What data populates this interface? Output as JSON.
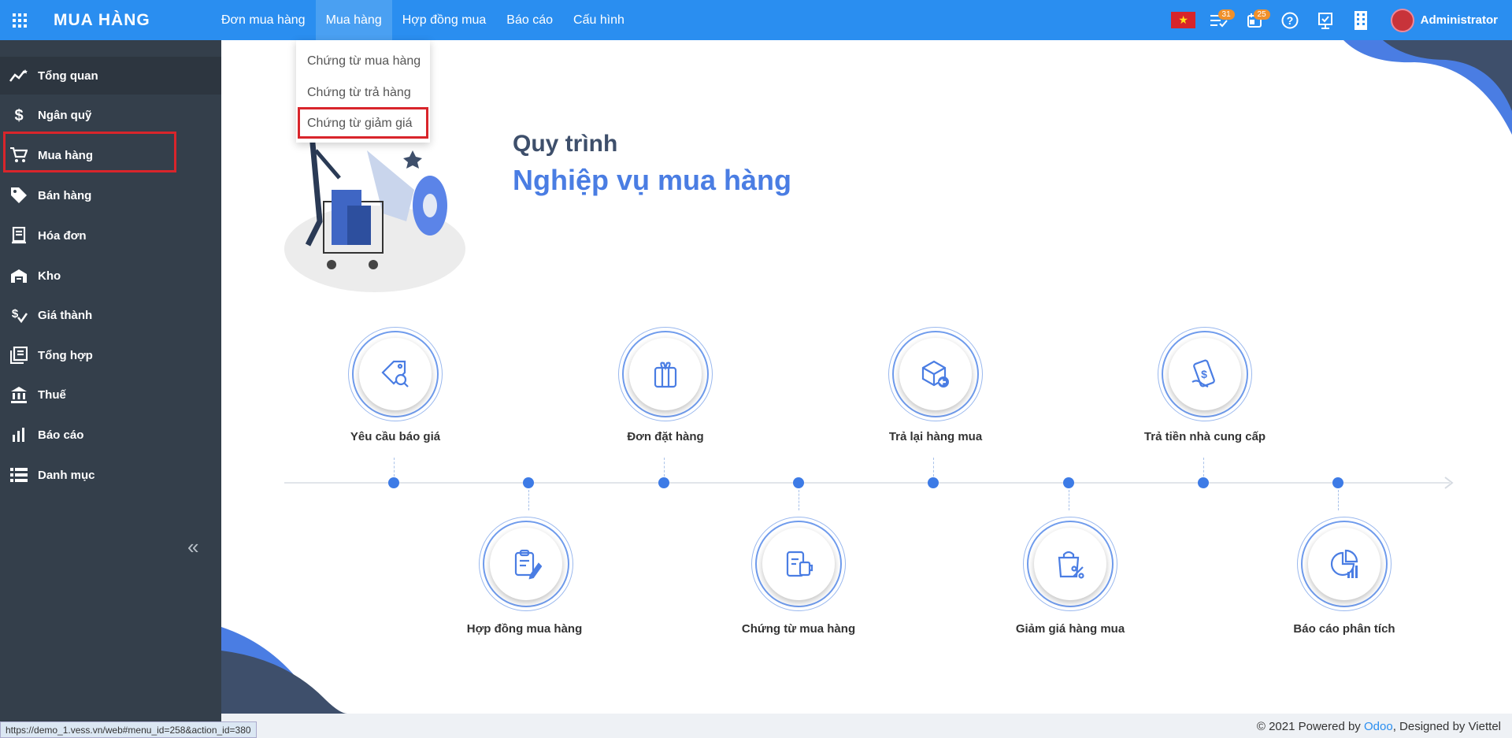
{
  "app": {
    "title": "MUA HÀNG"
  },
  "topmenu": [
    "Đơn mua hàng",
    "Mua hàng",
    "Hợp đồng mua",
    "Báo cáo",
    "Cấu hình"
  ],
  "topright": {
    "messages_count": "31",
    "activities_count": "25",
    "user_name": "Administrator"
  },
  "dropdown": [
    "Chứng từ mua hàng",
    "Chứng từ trả hàng",
    "Chứng từ giảm giá"
  ],
  "sidebar": {
    "items": [
      {
        "label": "Tổng quan",
        "icon": "trend-chart-icon"
      },
      {
        "label": "Ngân quỹ",
        "icon": "dollar-icon"
      },
      {
        "label": "Mua hàng",
        "icon": "cart-icon"
      },
      {
        "label": "Bán hàng",
        "icon": "tag-icon"
      },
      {
        "label": "Hóa đơn",
        "icon": "invoice-icon"
      },
      {
        "label": "Kho",
        "icon": "warehouse-icon"
      },
      {
        "label": "Giá thành",
        "icon": "cost-icon"
      },
      {
        "label": "Tổng hợp",
        "icon": "summary-icon"
      },
      {
        "label": "Thuế",
        "icon": "bank-icon"
      },
      {
        "label": "Báo cáo",
        "icon": "bar-chart-icon"
      },
      {
        "label": "Danh mục",
        "icon": "list-icon"
      }
    ]
  },
  "main": {
    "title_line1": "Quy trình",
    "title_line2": "Nghiệp vụ mua hàng",
    "steps_top": [
      "Yêu cầu báo giá",
      "Đơn đặt hàng",
      "Trả lại hàng mua",
      "Trả tiền nhà cung cấp"
    ],
    "steps_bottom": [
      "Hợp đồng mua hàng",
      "Chứng từ mua hàng",
      "Giảm giá hàng mua",
      "Báo cáo phân tích"
    ]
  },
  "footer": {
    "prefix": "© 2021 Powered by ",
    "odoo": "Odoo",
    "suffix": ", Designed by Viettel"
  },
  "status_url": "https://demo_1.vess.vn/web#menu_id=258&action_id=380",
  "colors": {
    "topbar": "#2a8ef0",
    "sidebar": "#343f4b",
    "accent": "#3d7be6",
    "highlight": "#d9252b"
  }
}
